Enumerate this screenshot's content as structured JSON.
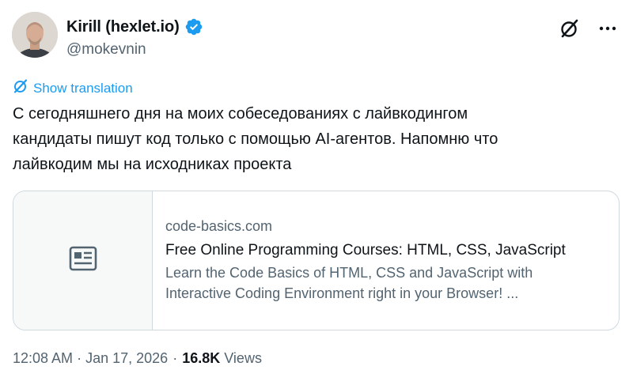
{
  "author": {
    "display_name": "Kirill (hexlet.io)",
    "handle": "@mokevnin",
    "verified": true
  },
  "icons": {
    "verified": "verified-badge-icon",
    "grok": "grok-icon",
    "more": "more-icon",
    "translate": "translate-icon",
    "card_placeholder": "article-icon"
  },
  "colors": {
    "accent": "#1d9bf0",
    "text": "#0f1419",
    "secondary": "#536471",
    "border": "#cfd9de"
  },
  "tweet": {
    "show_translation": "Show translation",
    "lines": [
      "С сегодняшнего дня на моих собеседованиях с лайвкодингом",
      "кандидаты пишут код только с помощью AI-агентов. Напомню что",
      "лайвкодим мы на исходниках проекта"
    ]
  },
  "card": {
    "domain": "code-basics.com",
    "title": "Free Online Programming Courses: HTML, CSS, JavaScript",
    "description_lines": [
      "Learn the Code Basics of HTML, CSS and JavaScript with",
      "Interactive Coding Environment right in your Browser! ..."
    ]
  },
  "meta": {
    "time": "12:08 AM",
    "separator": "·",
    "date": "Jan 17, 2026",
    "views_count": "16.8K",
    "views_label": "Views"
  }
}
